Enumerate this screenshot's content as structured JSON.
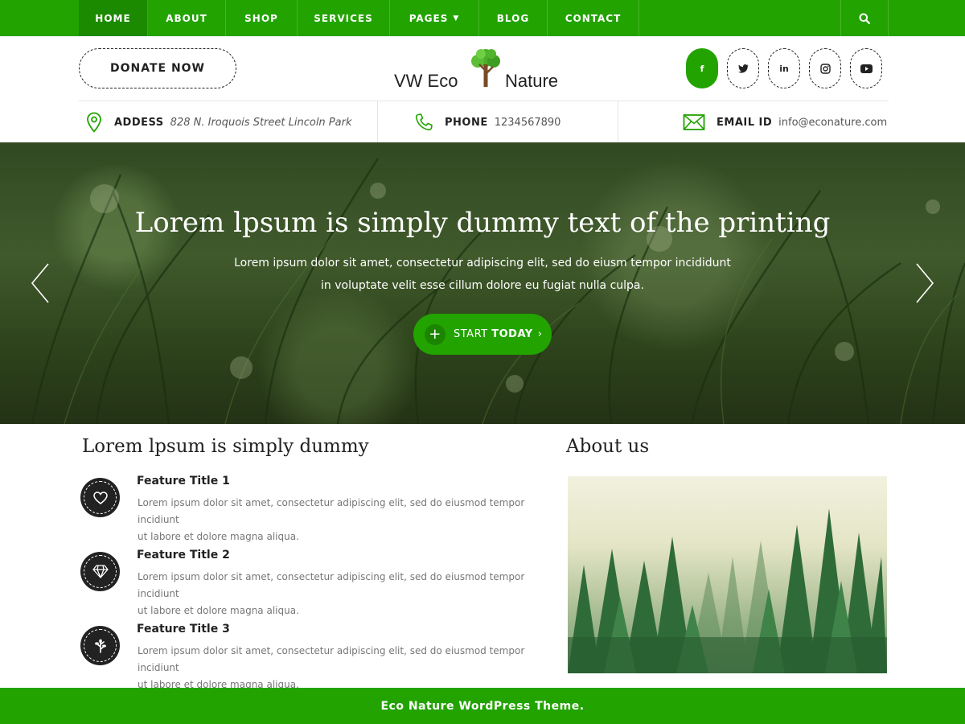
{
  "nav": {
    "items": [
      {
        "label": "HOME"
      },
      {
        "label": "ABOUT"
      },
      {
        "label": "SHOP"
      },
      {
        "label": "SERVICES"
      },
      {
        "label": "PAGES"
      },
      {
        "label": "BLOG"
      },
      {
        "label": "CONTACT"
      }
    ],
    "search_icon": "search-icon"
  },
  "header": {
    "donate_label": "DONATE NOW",
    "logo_left": "VW Eco",
    "logo_right": "Nature",
    "social": [
      {
        "icon": "facebook-icon",
        "glyph": "f"
      },
      {
        "icon": "twitter-icon",
        "glyph": "t"
      },
      {
        "icon": "linkedin-icon",
        "glyph": "in"
      },
      {
        "icon": "instagram-icon",
        "glyph": "◎"
      },
      {
        "icon": "youtube-icon",
        "glyph": "▶"
      }
    ]
  },
  "info": {
    "address_label": "ADDESS",
    "address_value": "828 N. Iroquois Street Lincoln Park",
    "phone_label": "PHONE",
    "phone_value": "1234567890",
    "email_label": "EMAIL ID",
    "email_value": "info@econature.com"
  },
  "hero": {
    "title": "Lorem lpsum is simply dummy text of the printing",
    "text_line1": "Lorem ipsum dolor sit amet, consectetur adipiscing elit, sed do eiusm tempor incididunt",
    "text_line2": "in voluptate velit esse cillum dolore eu fugiat nulla culpa.",
    "button_start": "START",
    "button_today": "TODAY"
  },
  "features": {
    "section_title": "Lorem lpsum is simply dummy",
    "items": [
      {
        "icon": "heart-icon",
        "title": "Feature Title 1",
        "text_line1": "Lorem ipsum dolor sit amet, consectetur adipiscing elit, sed do eiusmod tempor incidiunt",
        "text_line2": "ut labore et dolore magna aliqua."
      },
      {
        "icon": "diamond-icon",
        "title": "Feature Title 2",
        "text_line1": "Lorem ipsum dolor sit amet, consectetur adipiscing elit, sed do eiusmod tempor incidiunt",
        "text_line2": "ut labore et dolore magna aliqua."
      },
      {
        "icon": "leaf-icon",
        "title": "Feature Title 3",
        "text_line1": "Lorem ipsum dolor sit amet, consectetur adipiscing elit, sed do eiusmod tempor incidiunt",
        "text_line2": "ut labore et dolore magna aliqua."
      }
    ]
  },
  "about": {
    "title": "About us"
  },
  "footer": {
    "text": "Eco Nature WordPress Theme."
  },
  "colors": {
    "brand_green": "#22a300",
    "active_green": "#1c8a00",
    "dark": "#222222"
  }
}
